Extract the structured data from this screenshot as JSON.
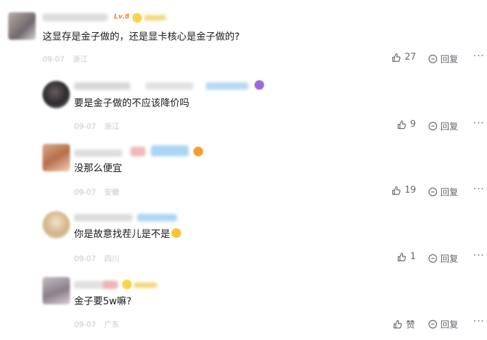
{
  "comments": [
    {
      "level": "Lv.8",
      "text": "这显存是金子做的，还是显卡核心是金子做的?",
      "date": "09-07",
      "location": "浙江",
      "likes": "27",
      "reply_label": "回复",
      "more": "···"
    },
    {
      "text": "要是金子做的不应该降价吗",
      "date": "09-07",
      "location": "浙江",
      "likes": "9",
      "reply_label": "回复",
      "more": "···"
    },
    {
      "text": "没那么便宜",
      "date": "09-07",
      "location": "安徽",
      "likes": "19",
      "reply_label": "回复",
      "more": "···"
    },
    {
      "text": "你是故意找茬儿是不是",
      "date": "09-07",
      "location": "四川",
      "likes": "1",
      "reply_label": "回复",
      "more": "···"
    },
    {
      "text": "金子要5w嘛?",
      "date": "09-07",
      "location": "广东",
      "likes": "赞",
      "reply_label": "回复",
      "more": "···"
    }
  ],
  "colors": {
    "accent": "#fb7299",
    "text": "#18191c",
    "meta": "#c4c4c4",
    "action": "#61666d"
  }
}
